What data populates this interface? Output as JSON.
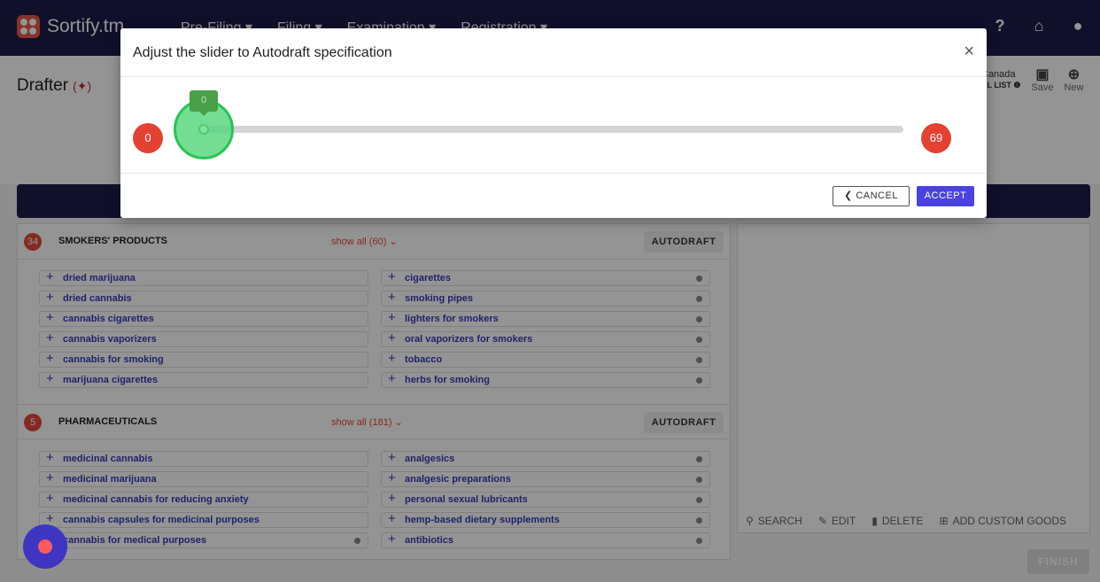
{
  "app": {
    "brand": "Sortify.tm",
    "nav": [
      "Pre-Filing ▾",
      "Filing ▾",
      "Examination ▾",
      "Registration ▾"
    ],
    "icon_help": "?",
    "icon_home": "⌂",
    "icon_user": "●"
  },
  "header": {
    "title": "Drafter",
    "flag": "(✦)",
    "region_line1": "Canada",
    "region_line2": "AL LIST ❶",
    "save_label": "Save",
    "new_label": "New",
    "save_icon": "▣",
    "new_icon": "⊕"
  },
  "categories": [
    {
      "count": "34",
      "name": "SMOKERS' PRODUCTS",
      "show_all": "show all (60) ⌄",
      "autodraft": "AUTODRAFT",
      "goods": [
        "dried marijuana",
        "cigarettes",
        "dried cannabis",
        "smoking pipes",
        "cannabis cigarettes",
        "lighters for smokers",
        "cannabis vaporizers",
        "oral vaporizers for smokers",
        "cannabis for smoking",
        "tobacco",
        "marijuana cigarettes",
        "herbs for smoking"
      ]
    },
    {
      "count": "5",
      "name": "PHARMACEUTICALS",
      "show_all": "show all (181) ⌄",
      "autodraft": "AUTODRAFT",
      "goods": [
        "medicinal cannabis",
        "analgesics",
        "medicinal marijuana",
        "analgesic preparations",
        "medicinal cannabis for reducing anxiety",
        "personal sexual lubricants",
        "cannabis capsules for medicinal purposes",
        "hemp-based dietary supplements",
        "cannabis for medical purposes",
        "antibiotics"
      ]
    }
  ],
  "toolbar": {
    "search": "SEARCH",
    "edit": "EDIT",
    "delete": "DELETE",
    "add_custom": "ADD CUSTOM GOODS",
    "finish": "FINISH"
  },
  "modal": {
    "title": "Adjust the slider to Autodraft specification",
    "close": "×",
    "slider_min": "0",
    "slider_max": "69",
    "slider_value": 0,
    "slider_tip": "0",
    "cancel": "❮ CANCEL",
    "accept": "ACCEPT"
  },
  "colors": {
    "navy": "#1e1d4b",
    "accent_red": "#e44132",
    "accept_blue": "#4a43e0",
    "slider_green": "#27c452"
  }
}
